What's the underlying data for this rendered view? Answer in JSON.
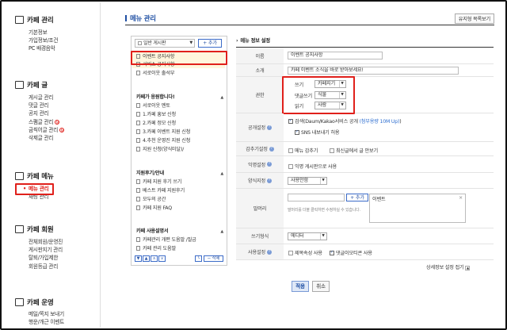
{
  "sidebar": {
    "sections": [
      {
        "title": "카페 관리",
        "icon": "monitor-icon",
        "items": [
          "기본정보",
          "가입정보/조건",
          "PC 배경음악"
        ]
      },
      {
        "title": "카페 글",
        "icon": "document-icon",
        "items": [
          "게시글 관리",
          "댓글 관리",
          "공지 관리",
          "스팸글 관리",
          "금칙어글 관리",
          "삭제글 관리"
        ]
      },
      {
        "title": "카페 메뉴",
        "icon": "menu-window-icon",
        "items": [
          "메뉴 관리",
          "채팅 관리"
        ]
      },
      {
        "title": "카페 회원",
        "icon": "member-card-icon",
        "items": [
          "전체회원/운영진",
          "게시판지기 관리",
          "탈퇴/가입제한",
          "회원등급 관리"
        ]
      },
      {
        "title": "카페 운영",
        "icon": "bar-chart-icon",
        "items": [
          "메일/쪽지 보내기",
          "행운/개근 이벤트"
        ]
      }
    ],
    "badge_new": "N"
  },
  "header": {
    "title": "메뉴 관리",
    "menu_list_button": "유지형 목록보기"
  },
  "tree": {
    "select_value": "일반 게시판",
    "add_label": "+ 추가",
    "items_top": [
      "이벤트 공지사항",
      "서비스 공지사항",
      "서로이웃 출석부"
    ],
    "group1": {
      "title": "카페가 응원합니다!",
      "items": [
        "서로이웃 멘토",
        "1.카페 홍보 신청",
        "2.카페 정모 신청",
        "3.카페 이벤트 지원 신청",
        "4.추천 운영진 지원 신청",
        "지원 신청(양식미달)/"
      ]
    },
    "group2": {
      "title": "지원후기/안내",
      "items": [
        "카페 지원 후기 쓰기",
        "베스트 카페 지원후기",
        "모두의 공간",
        "카페 지원 FAQ"
      ]
    },
    "group3": {
      "title": "카페 사용설명서",
      "items": [
        "카페관리 개편 도움말 /질금",
        "카페 관리 도움말"
      ]
    },
    "move_buttons": [
      "▼",
      "▲",
      "∧",
      "∨"
    ],
    "bracket_button": "└",
    "delete_button": "− 삭제"
  },
  "form": {
    "section_title": "메뉴 정보 설정",
    "name_label": "이름",
    "name_value": "이벤트 공지사항",
    "intro_label": "소개",
    "intro_value": "카페 이벤트 소식을 바로 받아보세요!",
    "perm_label": "권한",
    "perm_rows": [
      {
        "label": "쓰기",
        "value": "카페지기"
      },
      {
        "label": "댓글쓰기",
        "value": "식물"
      },
      {
        "label": "읽기",
        "value": "사람"
      }
    ],
    "public_label": "공개설정",
    "public_opt1": "검색(Daum/Kakao서비스 공개",
    "public_opt1_note": "(첨부용량 10M Up)",
    "public_opt1_close": ")",
    "public_opt2": "SNS 내보내기 허용",
    "review_label": "감추기설정",
    "review_opt1": "메뉴 감추기",
    "review_opt2": "최신글에서 글 안보기",
    "anon_label": "익명설정",
    "anon_opt": "익명 게시판으로 사용",
    "form_label": "양식지정",
    "form_value": "사용안함",
    "head_label": "말머리",
    "head_add": "+ 추가",
    "head_item": "이벤트",
    "head_close": "×",
    "head_help": "말머리를 더블 클릭하면 수정하실 수 있습니다.",
    "write_label": "쓰기형식",
    "write_value": "에디터",
    "use_label": "사용설정",
    "use_opt1": "제목속성 사용",
    "use_opt2": "댓글이모티콘 사용",
    "detail_link": "상세정보 설정 접기",
    "apply": "적용",
    "cancel": "취소"
  }
}
